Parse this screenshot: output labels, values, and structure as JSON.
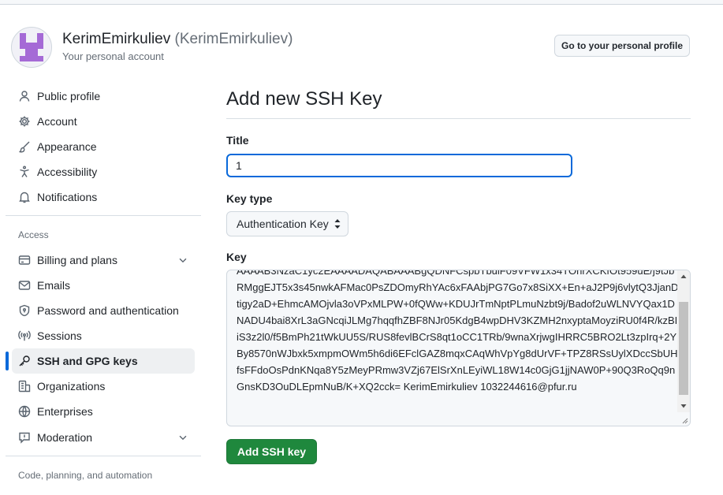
{
  "header": {
    "display_name": "KerimEmirkuliev",
    "login": "(KerimEmirkuliev)",
    "subtitle": "Your personal account",
    "profile_button": "Go to your personal profile"
  },
  "sidebar": {
    "group1": [
      {
        "label": "Public profile",
        "icon": "person-icon"
      },
      {
        "label": "Account",
        "icon": "gear-icon"
      },
      {
        "label": "Appearance",
        "icon": "paintbrush-icon"
      },
      {
        "label": "Accessibility",
        "icon": "accessibility-icon"
      },
      {
        "label": "Notifications",
        "icon": "bell-icon"
      }
    ],
    "access_heading": "Access",
    "group2": [
      {
        "label": "Billing and plans",
        "icon": "credit-card-icon",
        "expandable": true
      },
      {
        "label": "Emails",
        "icon": "mail-icon"
      },
      {
        "label": "Password and authentication",
        "icon": "shield-lock-icon"
      },
      {
        "label": "Sessions",
        "icon": "broadcast-icon"
      },
      {
        "label": "SSH and GPG keys",
        "icon": "key-icon",
        "active": true
      },
      {
        "label": "Organizations",
        "icon": "organization-icon"
      },
      {
        "label": "Enterprises",
        "icon": "globe-icon"
      },
      {
        "label": "Moderation",
        "icon": "report-icon",
        "expandable": true
      }
    ],
    "code_heading": "Code, planning, and automation"
  },
  "main": {
    "page_title": "Add new SSH Key",
    "title_label": "Title",
    "title_value": "1",
    "key_type_label": "Key type",
    "key_type_value": "Authentication Key",
    "key_label": "Key",
    "key_value": "AAAAB3NzaC1yc2EAAAADAQABAAABgQDNFCspbTbulF09VFW1x34TOhrXCKfOt959uE/j9tJbRMggEJT5x3s45nwkAFMac0PsZDOmyRhYAc6xFAAbjPG7Go7x8SiXX+En+aJ2P9j6vlytQ3JjanDtigy2aD+EhmcAMOjvla3oVPxMLPW+0fQWw+KDUJrTmNptPLmuNzbt9j/Badof2uWLNVYQax1DNADU4bai8XrL3aGNcqiJLMg7hqqfhZBF8NJr05KdgB4wpDHV3KZMH2nxyptaMoyziRU0f4R/kzBIiS3z2l0/f5BmPh21tWkUU5S/RUS8fevlBCrS8qt1oCC1TRb/9wnaXrjwgIHRRC5BRO2Lt3zpIrq+2YBy8570nWJbxk5xmpmOWm5h6di6EFclGAZ8mqxCAqWhVpYg8dUrVF+TPZ8RSsUylXDccSbUHfsFFdoOsPdnKNqa8Y5zMeyPRmw3VZj67ElSrXnLEyiWL18W14c0GjG1jjNAW0P+90Q3RoQq9nGnsKD3OuDLEpmNuB/K+XQ2cck= KerimEmirkuliev 1032244616@pfur.ru",
    "submit_label": "Add SSH key"
  },
  "colors": {
    "accent": "#0969da",
    "primary_button": "#1f883d",
    "avatar": "#a56ad6"
  }
}
